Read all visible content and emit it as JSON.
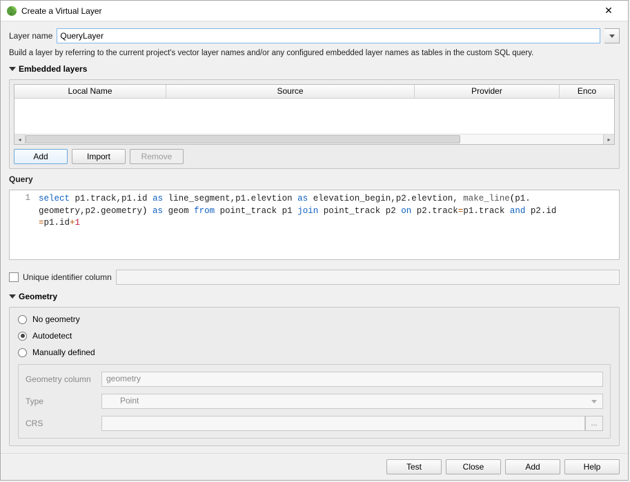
{
  "title": "Create a Virtual Layer",
  "layerName": {
    "label": "Layer name",
    "value": "QueryLayer"
  },
  "description": "Build a layer by referring to the current project's vector layer names and/or any configured embedded layer names as tables in the custom SQL query.",
  "embedded": {
    "heading": "Embedded layers",
    "columns": [
      "Local Name",
      "Source",
      "Provider",
      "Enco"
    ],
    "buttons": {
      "add": "Add",
      "import": "Import",
      "remove": "Remove"
    }
  },
  "query": {
    "label": "Query",
    "lineNo": "1",
    "sql": {
      "full": "select p1.track,p1.id as line_segment,p1.elevtion as elevation_begin,p2.elevtion, make_line(p1.geometry,p2.geometry) as geom from point_track p1 join point_track p2 on p2.track=p1.track and p2.id=p1.id+1"
    }
  },
  "uic": {
    "label": "Unique identifier column"
  },
  "geometry": {
    "heading": "Geometry",
    "options": {
      "none": "No geometry",
      "auto": "Autodetect",
      "manual": "Manually defined"
    },
    "selected": "auto",
    "details": {
      "colLabel": "Geometry column",
      "colValue": "geometry",
      "typeLabel": "Type",
      "typeValue": "Point",
      "crsLabel": "CRS",
      "crsBtn": "..."
    }
  },
  "footer": {
    "test": "Test",
    "close": "Close",
    "add": "Add",
    "help": "Help"
  }
}
